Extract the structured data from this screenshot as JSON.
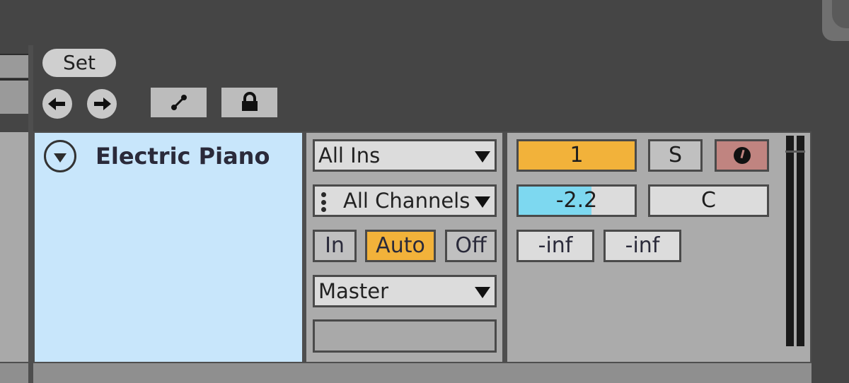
{
  "toolbar": {
    "set_label": "Set",
    "icons": {
      "prev": "arrow-left-icon",
      "next": "arrow-right-icon",
      "link": "link-icon",
      "lock": "lock-icon"
    }
  },
  "track": {
    "name": "Electric Piano",
    "fold_icon": "triangle-down-icon",
    "input_type": "All Ins",
    "input_channel": "All Channels",
    "monitor": {
      "options": [
        "In",
        "Auto",
        "Off"
      ],
      "selected": "Auto"
    },
    "output_type": "Master",
    "output_channel": "",
    "activator_label": "1",
    "solo_label": "S",
    "arm_icon": "record-arm-icon",
    "volume": {
      "value": "-2.2",
      "fill_fraction": 0.63
    },
    "pan": "C",
    "peak_left": "-inf",
    "peak_right": "-inf"
  },
  "colors": {
    "track_bg": "#c8e6fb",
    "accent_orange": "#f2b23a",
    "volume_blue": "#7dd8f0",
    "arm_red": "#c08480"
  }
}
